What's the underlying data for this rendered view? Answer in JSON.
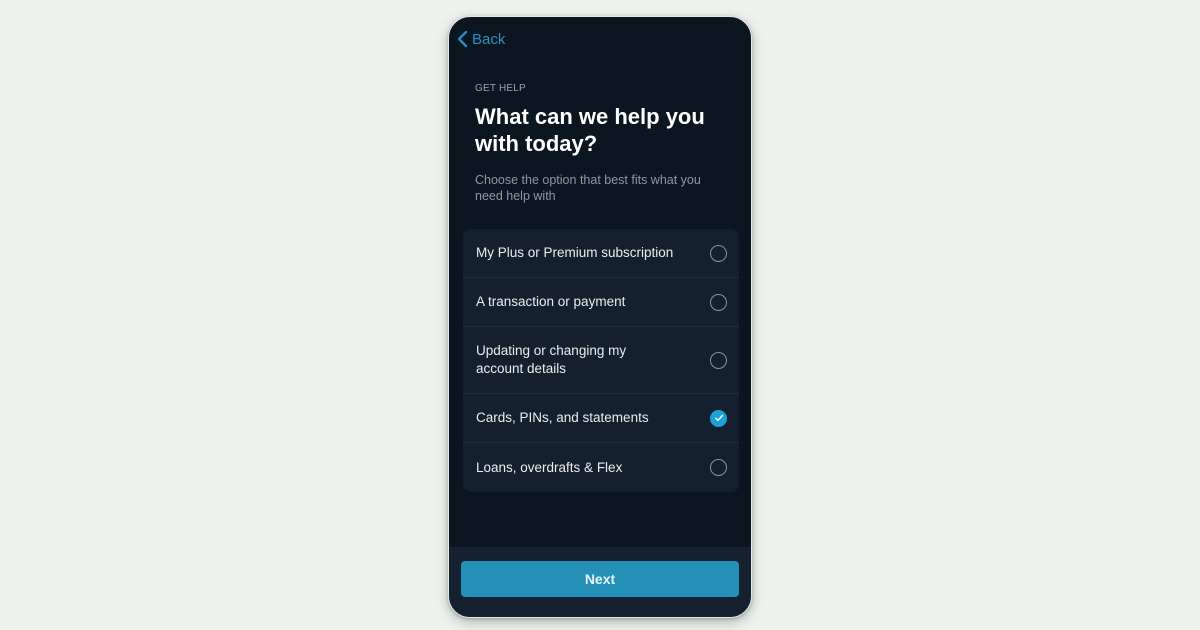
{
  "nav": {
    "back_label": "Back"
  },
  "header": {
    "eyebrow": "GET HELP",
    "title": "What can we help you with today?",
    "subtitle": "Choose the option that best fits what you need help with"
  },
  "options": [
    {
      "label": "My Plus or Premium subscription",
      "selected": false
    },
    {
      "label": "A transaction or payment",
      "selected": false
    },
    {
      "label": "Updating or changing my account details",
      "selected": false
    },
    {
      "label": "Cards, PINs, and statements",
      "selected": true
    },
    {
      "label": "Loans, overdrafts & Flex",
      "selected": false
    }
  ],
  "footer": {
    "next_label": "Next"
  },
  "colors": {
    "accent": "#1ea0d8",
    "button": "#2490b8",
    "background": "#0b1620",
    "card": "#15202e"
  }
}
